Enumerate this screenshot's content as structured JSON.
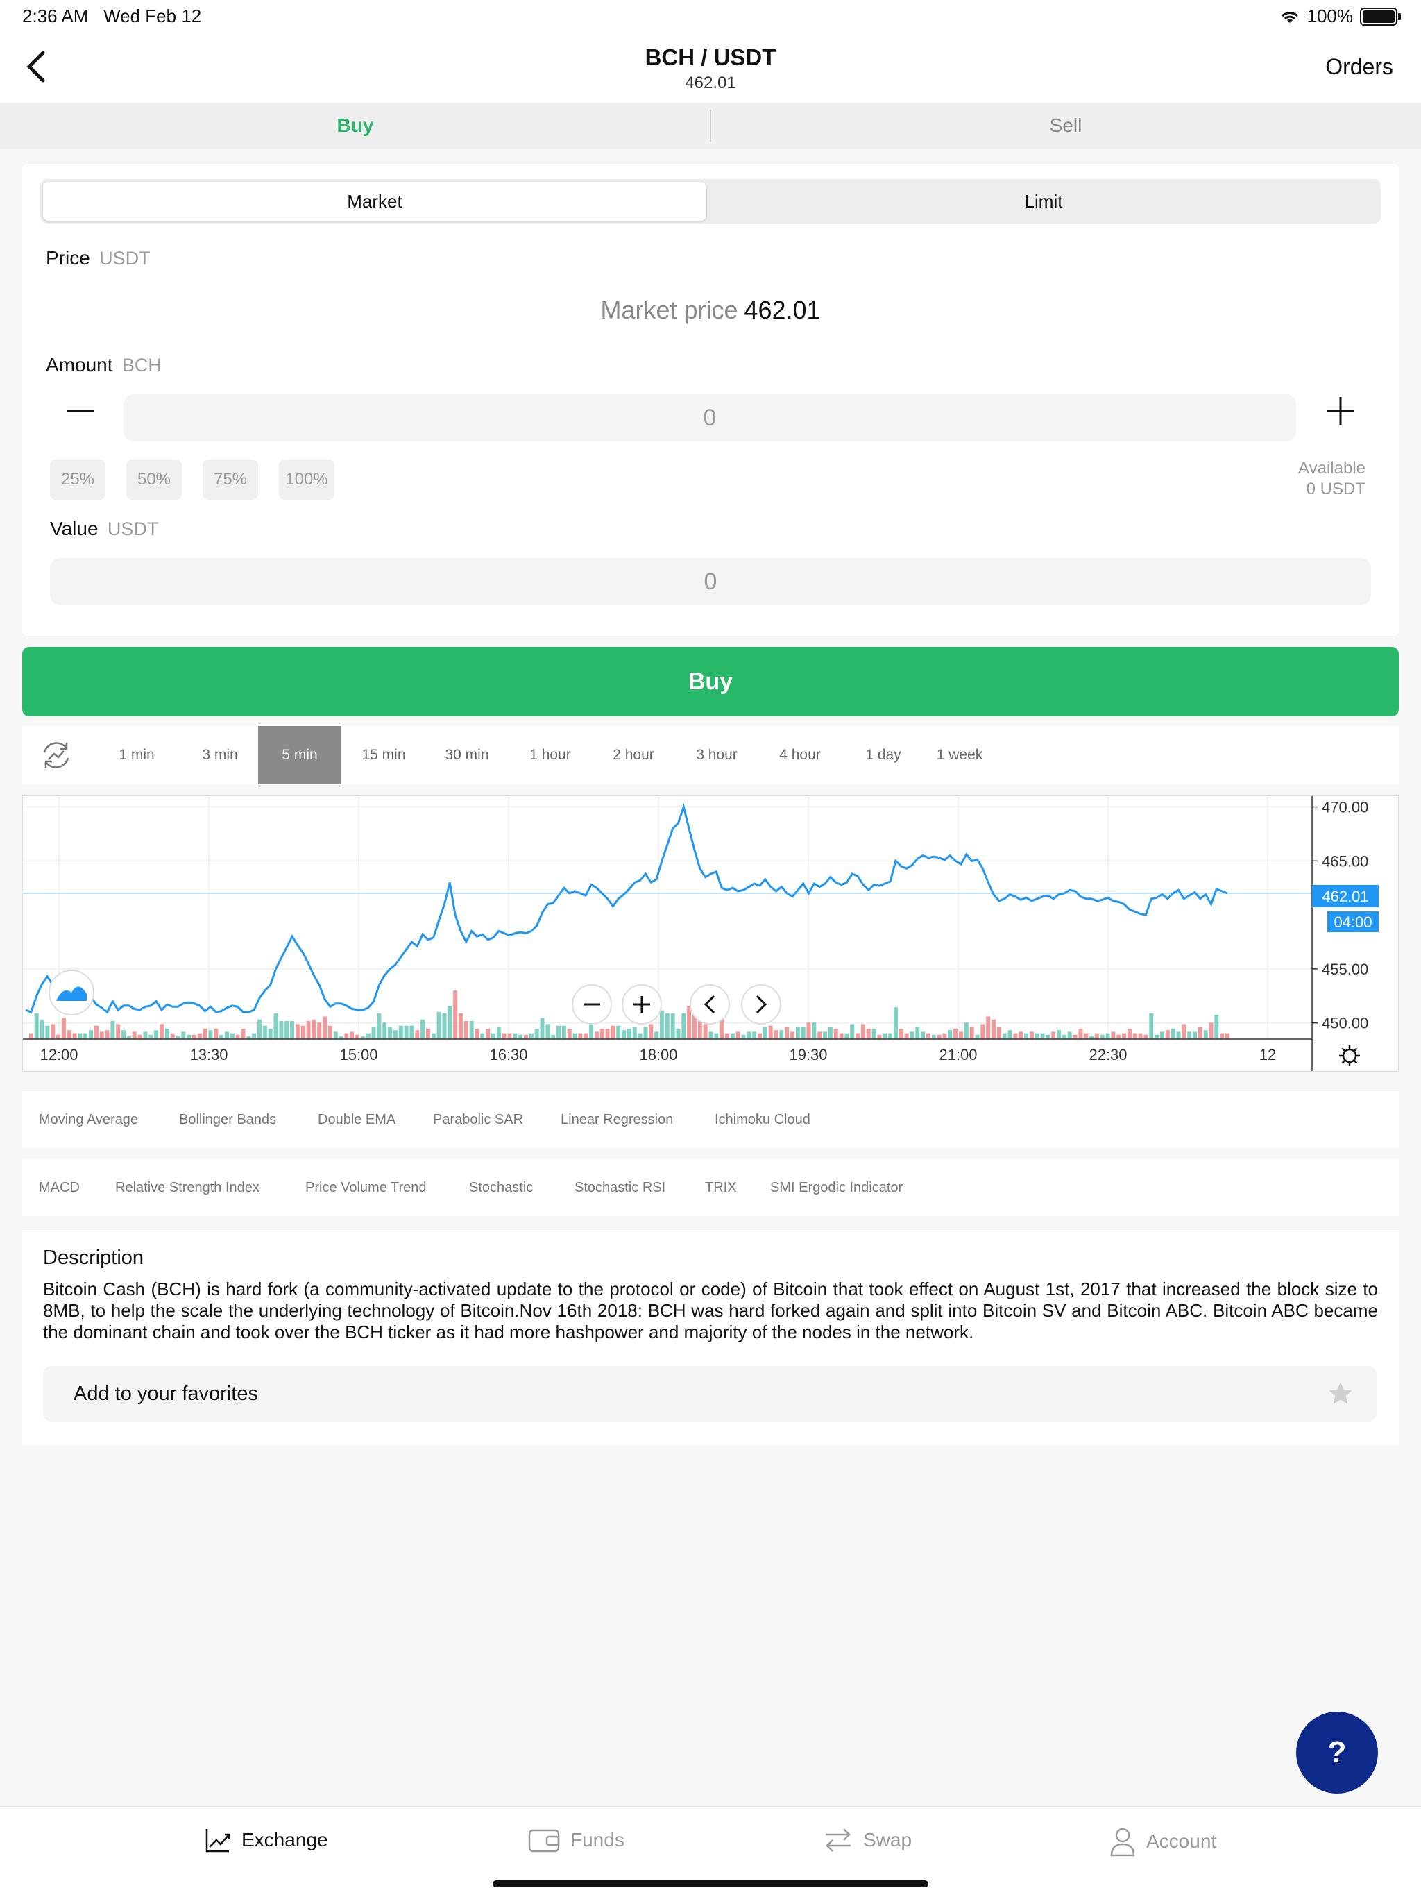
{
  "status": {
    "time": "2:36 AM",
    "date": "Wed Feb 12",
    "battery": "100%"
  },
  "header": {
    "title": "BCH / USDT",
    "subtitle": "462.01",
    "orders_label": "Orders"
  },
  "trade_tabs": [
    {
      "label": "Buy",
      "active": true
    },
    {
      "label": "Sell",
      "active": false
    }
  ],
  "order_type": {
    "market": "Market",
    "limit": "Limit",
    "selected": "Market"
  },
  "price": {
    "label": "Price",
    "unit": "USDT",
    "market_label": "Market price",
    "market_value": "462.01"
  },
  "amount": {
    "label": "Amount",
    "unit": "BCH",
    "value": "0",
    "percents": [
      "25%",
      "50%",
      "75%",
      "100%"
    ],
    "available_label": "Available",
    "available_value": "0 USDT"
  },
  "value": {
    "label": "Value",
    "unit": "USDT",
    "value": "0"
  },
  "buy_button": "Buy",
  "intervals": [
    "1 min",
    "3 min",
    "5 min",
    "15 min",
    "30 min",
    "1 hour",
    "2 hour",
    "3 hour",
    "4 hour",
    "1 day",
    "1 week"
  ],
  "selected_interval": "5 min",
  "chart_data": {
    "type": "line",
    "x_ticks": [
      "12:00",
      "13:30",
      "15:00",
      "16:30",
      "18:00",
      "19:30",
      "21:00",
      "22:30",
      "12"
    ],
    "y_ticks": [
      "470.00",
      "465.00",
      "455.00",
      "450.00"
    ],
    "ylim": [
      448.5,
      471
    ],
    "current_price_label": "462.01",
    "countdown_label": "04:00",
    "series": [
      {
        "values": [
          451.2,
          451.0,
          452.5,
          453.6,
          454.3,
          453.5,
          453.4,
          452.2,
          451.8,
          451.6,
          451.8,
          452.0,
          452.4,
          451.7,
          451.4,
          451.0,
          452.0,
          451.2,
          451.6,
          451.6,
          451.3,
          451.2,
          451.5,
          451.6,
          452.0,
          451.2,
          451.7,
          451.5,
          451.5,
          451.8,
          451.9,
          451.8,
          451.6,
          451.1,
          451.5,
          451.0,
          451.1,
          451.4,
          451.6,
          451.5,
          451.0,
          451.0,
          451.2,
          452.3,
          453.0,
          453.5,
          455.0,
          456.0,
          457.0,
          458.0,
          457.2,
          456.5,
          455.5,
          454.4,
          453.5,
          452.2,
          451.5,
          451.8,
          451.8,
          451.6,
          451.3,
          451.2,
          451.2,
          451.4,
          452.0,
          453.5,
          454.4,
          455.0,
          455.4,
          456.1,
          456.8,
          457.5,
          457.1,
          458.2,
          457.7,
          457.9,
          459.5,
          461.0,
          463.0,
          460.0,
          458.5,
          457.5,
          458.5,
          458.0,
          458.2,
          457.7,
          457.9,
          458.5,
          458.3,
          458.1,
          458.3,
          458.4,
          458.3,
          458.5,
          459.0,
          460.2,
          461.0,
          461.1,
          461.8,
          462.5,
          462.0,
          462.2,
          462.0,
          461.8,
          462.8,
          462.5,
          462.0,
          461.5,
          460.8,
          461.5,
          461.9,
          462.4,
          463.0,
          463.2,
          463.8,
          463.0,
          463.3,
          465.0,
          466.5,
          468.0,
          468.5,
          470.0,
          468.0,
          466.0,
          464.3,
          463.5,
          463.8,
          464.0,
          462.5,
          462.3,
          462.5,
          462.2,
          462.3,
          462.6,
          462.9,
          462.7,
          463.3,
          462.6,
          462.2,
          462.6,
          462.0,
          461.7,
          462.3,
          462.9,
          462.0,
          462.9,
          462.6,
          462.9,
          463.5,
          463.0,
          462.8,
          463.0,
          463.8,
          463.6,
          462.8,
          462.3,
          462.8,
          462.7,
          462.9,
          463.1,
          465.0,
          464.5,
          464.3,
          464.6,
          465.2,
          465.5,
          465.3,
          465.4,
          465.3,
          465.1,
          465.5,
          465.0,
          464.7,
          465.6,
          465.0,
          465.1,
          464.3,
          463.0,
          461.9,
          461.3,
          461.5,
          461.9,
          461.7,
          461.4,
          461.6,
          461.3,
          461.5,
          461.7,
          461.8,
          461.5,
          461.9,
          462.0,
          462.3,
          462.2,
          461.7,
          461.5,
          461.5,
          461.3,
          461.4,
          461.6,
          461.3,
          461.2,
          461.0,
          460.5,
          460.3,
          460.1,
          460.0,
          461.5,
          461.6,
          461.9,
          461.5,
          462.0,
          462.3,
          461.5,
          461.8,
          462.1,
          461.5,
          461.9,
          461.0,
          462.4,
          462.2,
          462.0
        ]
      }
    ]
  },
  "overlays": [
    "Moving Average",
    "Bollinger Bands",
    "Double EMA",
    "Parabolic SAR",
    "Linear Regression",
    "Ichimoku Cloud"
  ],
  "oscillators": [
    "MACD",
    "Relative Strength Index",
    "Price Volume Trend",
    "Stochastic",
    "Stochastic RSI",
    "TRIX",
    "SMI Ergodic Indicator"
  ],
  "description": {
    "title": "Description",
    "text": "Bitcoin Cash (BCH) is hard fork (a community-activated update to the protocol or code) of Bitcoin that took effect on August 1st, 2017 that increased the block size to 8MB, to help the scale the underlying technology of Bitcoin.Nov 16th 2018: BCH was hard forked again and split into Bitcoin SV and Bitcoin ABC. Bitcoin ABC became the dominant chain and took over the BCH ticker as it had more hashpower and majority of the nodes in the network.",
    "favorites_label": "Add to your favorites"
  },
  "help_label": "?",
  "bottom_nav": [
    {
      "label": "Exchange",
      "icon": "chart-icon",
      "active": true
    },
    {
      "label": "Funds",
      "icon": "wallet-icon",
      "active": false
    },
    {
      "label": "Swap",
      "icon": "swap-icon",
      "active": false
    },
    {
      "label": "Account",
      "icon": "person-icon",
      "active": false
    }
  ],
  "colors": {
    "accent": "#2bb56a",
    "line": "#2196f3",
    "up": "#7fd1c4",
    "down": "#f29a9a",
    "help": "#0d2a8a"
  }
}
